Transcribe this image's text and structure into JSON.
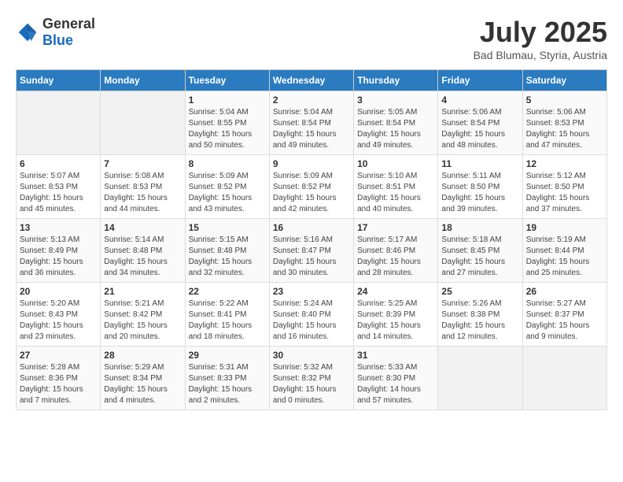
{
  "header": {
    "logo_general": "General",
    "logo_blue": "Blue",
    "month": "July 2025",
    "location": "Bad Blumau, Styria, Austria"
  },
  "weekdays": [
    "Sunday",
    "Monday",
    "Tuesday",
    "Wednesday",
    "Thursday",
    "Friday",
    "Saturday"
  ],
  "weeks": [
    [
      {
        "day": "",
        "empty": true
      },
      {
        "day": "",
        "empty": true
      },
      {
        "day": "1",
        "sunrise": "Sunrise: 5:04 AM",
        "sunset": "Sunset: 8:55 PM",
        "daylight": "Daylight: 15 hours and 50 minutes."
      },
      {
        "day": "2",
        "sunrise": "Sunrise: 5:04 AM",
        "sunset": "Sunset: 8:54 PM",
        "daylight": "Daylight: 15 hours and 49 minutes."
      },
      {
        "day": "3",
        "sunrise": "Sunrise: 5:05 AM",
        "sunset": "Sunset: 8:54 PM",
        "daylight": "Daylight: 15 hours and 49 minutes."
      },
      {
        "day": "4",
        "sunrise": "Sunrise: 5:06 AM",
        "sunset": "Sunset: 8:54 PM",
        "daylight": "Daylight: 15 hours and 48 minutes."
      },
      {
        "day": "5",
        "sunrise": "Sunrise: 5:06 AM",
        "sunset": "Sunset: 8:53 PM",
        "daylight": "Daylight: 15 hours and 47 minutes."
      }
    ],
    [
      {
        "day": "6",
        "sunrise": "Sunrise: 5:07 AM",
        "sunset": "Sunset: 8:53 PM",
        "daylight": "Daylight: 15 hours and 45 minutes."
      },
      {
        "day": "7",
        "sunrise": "Sunrise: 5:08 AM",
        "sunset": "Sunset: 8:53 PM",
        "daylight": "Daylight: 15 hours and 44 minutes."
      },
      {
        "day": "8",
        "sunrise": "Sunrise: 5:09 AM",
        "sunset": "Sunset: 8:52 PM",
        "daylight": "Daylight: 15 hours and 43 minutes."
      },
      {
        "day": "9",
        "sunrise": "Sunrise: 5:09 AM",
        "sunset": "Sunset: 8:52 PM",
        "daylight": "Daylight: 15 hours and 42 minutes."
      },
      {
        "day": "10",
        "sunrise": "Sunrise: 5:10 AM",
        "sunset": "Sunset: 8:51 PM",
        "daylight": "Daylight: 15 hours and 40 minutes."
      },
      {
        "day": "11",
        "sunrise": "Sunrise: 5:11 AM",
        "sunset": "Sunset: 8:50 PM",
        "daylight": "Daylight: 15 hours and 39 minutes."
      },
      {
        "day": "12",
        "sunrise": "Sunrise: 5:12 AM",
        "sunset": "Sunset: 8:50 PM",
        "daylight": "Daylight: 15 hours and 37 minutes."
      }
    ],
    [
      {
        "day": "13",
        "sunrise": "Sunrise: 5:13 AM",
        "sunset": "Sunset: 8:49 PM",
        "daylight": "Daylight: 15 hours and 36 minutes."
      },
      {
        "day": "14",
        "sunrise": "Sunrise: 5:14 AM",
        "sunset": "Sunset: 8:48 PM",
        "daylight": "Daylight: 15 hours and 34 minutes."
      },
      {
        "day": "15",
        "sunrise": "Sunrise: 5:15 AM",
        "sunset": "Sunset: 8:48 PM",
        "daylight": "Daylight: 15 hours and 32 minutes."
      },
      {
        "day": "16",
        "sunrise": "Sunrise: 5:16 AM",
        "sunset": "Sunset: 8:47 PM",
        "daylight": "Daylight: 15 hours and 30 minutes."
      },
      {
        "day": "17",
        "sunrise": "Sunrise: 5:17 AM",
        "sunset": "Sunset: 8:46 PM",
        "daylight": "Daylight: 15 hours and 28 minutes."
      },
      {
        "day": "18",
        "sunrise": "Sunrise: 5:18 AM",
        "sunset": "Sunset: 8:45 PM",
        "daylight": "Daylight: 15 hours and 27 minutes."
      },
      {
        "day": "19",
        "sunrise": "Sunrise: 5:19 AM",
        "sunset": "Sunset: 8:44 PM",
        "daylight": "Daylight: 15 hours and 25 minutes."
      }
    ],
    [
      {
        "day": "20",
        "sunrise": "Sunrise: 5:20 AM",
        "sunset": "Sunset: 8:43 PM",
        "daylight": "Daylight: 15 hours and 23 minutes."
      },
      {
        "day": "21",
        "sunrise": "Sunrise: 5:21 AM",
        "sunset": "Sunset: 8:42 PM",
        "daylight": "Daylight: 15 hours and 20 minutes."
      },
      {
        "day": "22",
        "sunrise": "Sunrise: 5:22 AM",
        "sunset": "Sunset: 8:41 PM",
        "daylight": "Daylight: 15 hours and 18 minutes."
      },
      {
        "day": "23",
        "sunrise": "Sunrise: 5:24 AM",
        "sunset": "Sunset: 8:40 PM",
        "daylight": "Daylight: 15 hours and 16 minutes."
      },
      {
        "day": "24",
        "sunrise": "Sunrise: 5:25 AM",
        "sunset": "Sunset: 8:39 PM",
        "daylight": "Daylight: 15 hours and 14 minutes."
      },
      {
        "day": "25",
        "sunrise": "Sunrise: 5:26 AM",
        "sunset": "Sunset: 8:38 PM",
        "daylight": "Daylight: 15 hours and 12 minutes."
      },
      {
        "day": "26",
        "sunrise": "Sunrise: 5:27 AM",
        "sunset": "Sunset: 8:37 PM",
        "daylight": "Daylight: 15 hours and 9 minutes."
      }
    ],
    [
      {
        "day": "27",
        "sunrise": "Sunrise: 5:28 AM",
        "sunset": "Sunset: 8:36 PM",
        "daylight": "Daylight: 15 hours and 7 minutes."
      },
      {
        "day": "28",
        "sunrise": "Sunrise: 5:29 AM",
        "sunset": "Sunset: 8:34 PM",
        "daylight": "Daylight: 15 hours and 4 minutes."
      },
      {
        "day": "29",
        "sunrise": "Sunrise: 5:31 AM",
        "sunset": "Sunset: 8:33 PM",
        "daylight": "Daylight: 15 hours and 2 minutes."
      },
      {
        "day": "30",
        "sunrise": "Sunrise: 5:32 AM",
        "sunset": "Sunset: 8:32 PM",
        "daylight": "Daylight: 15 hours and 0 minutes."
      },
      {
        "day": "31",
        "sunrise": "Sunrise: 5:33 AM",
        "sunset": "Sunset: 8:30 PM",
        "daylight": "Daylight: 14 hours and 57 minutes."
      },
      {
        "day": "",
        "empty": true
      },
      {
        "day": "",
        "empty": true
      }
    ]
  ]
}
